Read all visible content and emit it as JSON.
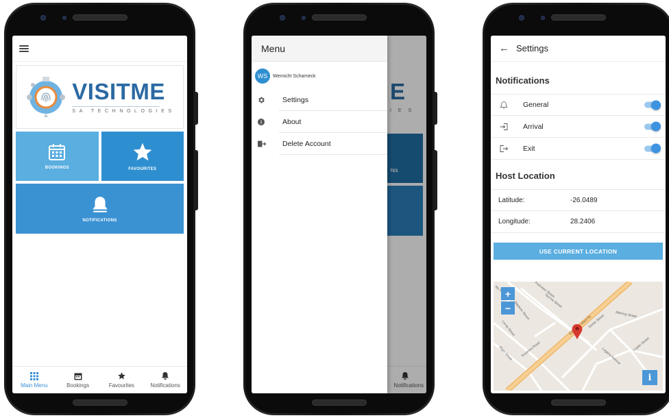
{
  "screen1": {
    "logo": {
      "word_a": "VISIT",
      "word_b": "ME",
      "subtitle": "SA TECHNOLOGIES"
    },
    "tiles": [
      {
        "label": "BOOKINGS",
        "icon": "calendar-icon"
      },
      {
        "label": "FAVOURITES",
        "icon": "star-icon"
      },
      {
        "label": "NOTIFICATIONS",
        "icon": "bell-icon"
      }
    ],
    "bottom_nav": [
      {
        "label": "Main Menu",
        "icon": "grid-icon",
        "active": true
      },
      {
        "label": "Bookings",
        "icon": "calendar-icon",
        "active": false
      },
      {
        "label": "Favourites",
        "icon": "star-icon",
        "active": false
      },
      {
        "label": "Notifications",
        "icon": "bell-icon",
        "active": false
      }
    ]
  },
  "screen2": {
    "drawer_title": "Menu",
    "user": {
      "initials": "WS",
      "name": "Wernicht Scharneck"
    },
    "items": [
      {
        "label": "Settings",
        "icon": "gear-icon"
      },
      {
        "label": "About",
        "icon": "info-icon"
      },
      {
        "label": "Delete Account",
        "icon": "logout-icon"
      }
    ],
    "peek_logo_text": "E",
    "peek_logo_sub": "I E S",
    "peek_tile_text": "TES",
    "peek_nav_label": "Notifications"
  },
  "screen3": {
    "title": "Settings",
    "notifications_header": "Notifications",
    "toggles": [
      {
        "label": "General",
        "icon": "bell-outline-icon",
        "on": true
      },
      {
        "label": "Arrival",
        "icon": "login-icon",
        "on": true
      },
      {
        "label": "Exit",
        "icon": "exit-icon",
        "on": true
      }
    ],
    "host_location_header": "Host Location",
    "latitude_label": "Latitude:",
    "latitude_value": "-26.0489",
    "longitude_label": "Longitude:",
    "longitude_value": "28.2406",
    "use_location_button": "USE CURRENT LOCATION",
    "map": {
      "zoom_in": "+",
      "zoom_out": "−",
      "info": "i",
      "street_labels": [
        "Norma Street",
        "Marlene Street",
        "Lorna Street",
        "Susanna Road",
        "Gerke Street",
        "Meiring Street",
        "Lugano Avenue",
        "Cuyler Street",
        "Elgin Street",
        "Parkview Street",
        "Ny Street"
      ],
      "road_label": "Edenvale Ward 91"
    }
  },
  "colors": {
    "accent": "#2e8fd0",
    "tile_light": "#5aaee0",
    "logo_blue": "#2b6aa3"
  }
}
